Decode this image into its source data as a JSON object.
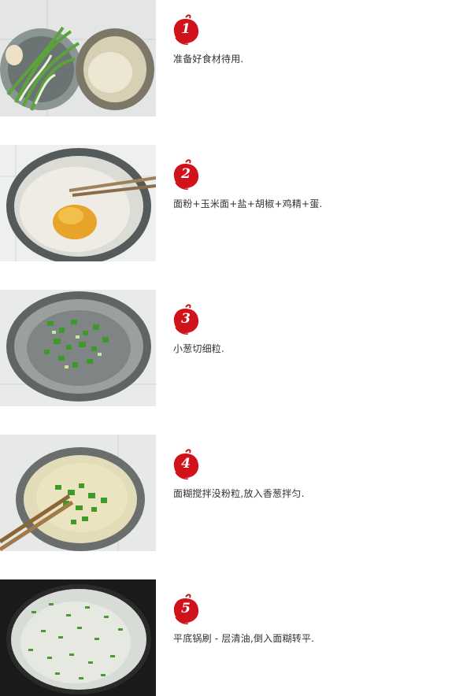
{
  "steps": [
    {
      "number": "1",
      "text": "准备好食材待用."
    },
    {
      "number": "2",
      "text": "面粉+玉米面+盐+胡椒+鸡精+蛋."
    },
    {
      "number": "3",
      "text": "小葱切细粒."
    },
    {
      "number": "4",
      "text": "面糊搅拌没粉粒,放入香葱拌匀."
    },
    {
      "number": "5",
      "text": "平底锅刷 - 层清油,倒入面糊转平."
    }
  ],
  "colors": {
    "badge_red": "#d0121b",
    "text": "#333333"
  },
  "icons": [
    "step-number-badge-icon"
  ]
}
